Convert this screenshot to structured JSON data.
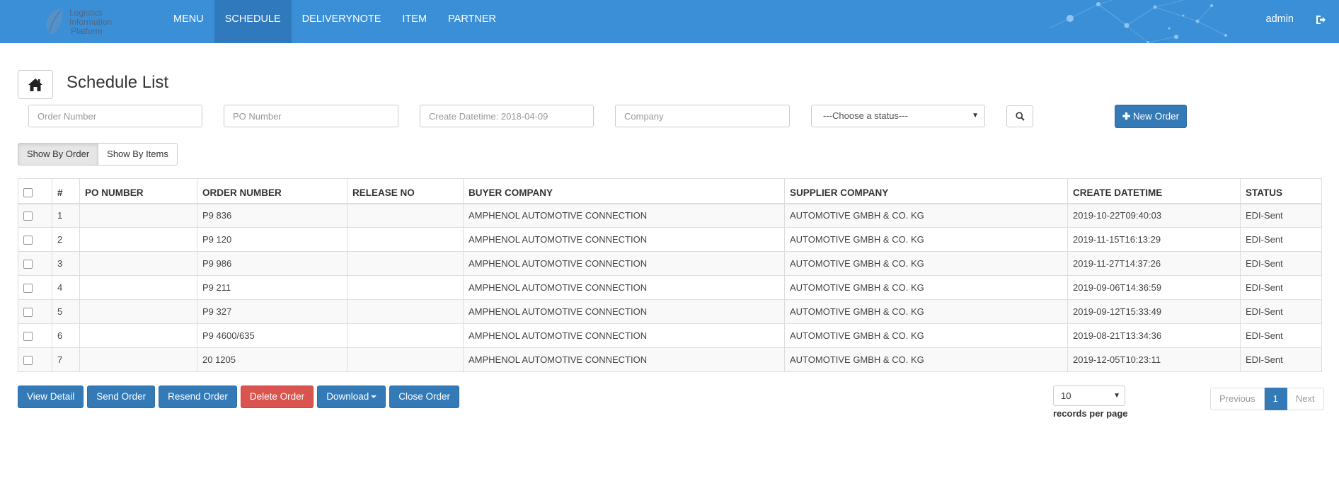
{
  "colors": {
    "navbar": "#3b8fd6",
    "nav_active": "#2f79bc",
    "primary": "#337ab7",
    "danger": "#d9534f"
  },
  "logo": {
    "line1": "Logistics",
    "line2": "Information",
    "line3": "Platform"
  },
  "nav": {
    "items": [
      {
        "label": "MENU"
      },
      {
        "label": "SCHEDULE"
      },
      {
        "label": "DELIVERYNOTE"
      },
      {
        "label": "ITEM"
      },
      {
        "label": "PARTNER"
      }
    ],
    "active": "SCHEDULE",
    "user": "admin"
  },
  "page": {
    "title": "Schedule List",
    "home_icon": "home-icon"
  },
  "filters": {
    "order_number_placeholder": "Order Number",
    "po_number_placeholder": "PO Number",
    "create_datetime_placeholder": "Create Datetime: 2018-04-09",
    "company_placeholder": "Company",
    "status_selected": "---Choose a status---",
    "new_order_label": "New Order"
  },
  "view_toggle": {
    "by_order": "Show By Order",
    "by_items": "Show By Items"
  },
  "table": {
    "headers": [
      "#",
      "PO NUMBER",
      "ORDER NUMBER",
      "RELEASE NO",
      "BUYER COMPANY",
      "SUPPLIER COMPANY",
      "CREATE DATETIME",
      "STATUS"
    ],
    "rows": [
      {
        "num": "1",
        "po": "",
        "order": "P9  836",
        "release": "",
        "buyer": "AMPHENOL AUTOMOTIVE CONNECTION",
        "supplier": "AUTOMOTIVE GMBH & CO. KG",
        "created": "2019-10-22T09:40:03",
        "status": "EDI-Sent"
      },
      {
        "num": "2",
        "po": "",
        "order": "P9  120",
        "release": "",
        "buyer": "AMPHENOL AUTOMOTIVE CONNECTION",
        "supplier": "AUTOMOTIVE GMBH & CO. KG",
        "created": "2019-11-15T16:13:29",
        "status": "EDI-Sent"
      },
      {
        "num": "3",
        "po": "",
        "order": "P9  986",
        "release": "",
        "buyer": "AMPHENOL AUTOMOTIVE CONNECTION",
        "supplier": "AUTOMOTIVE GMBH & CO. KG",
        "created": "2019-11-27T14:37:26",
        "status": "EDI-Sent"
      },
      {
        "num": "4",
        "po": "",
        "order": "P9  211",
        "release": "",
        "buyer": "AMPHENOL AUTOMOTIVE CONNECTION",
        "supplier": "AUTOMOTIVE GMBH & CO. KG",
        "created": "2019-09-06T14:36:59",
        "status": "EDI-Sent"
      },
      {
        "num": "5",
        "po": "",
        "order": "P9  327",
        "release": "",
        "buyer": "AMPHENOL AUTOMOTIVE CONNECTION",
        "supplier": "AUTOMOTIVE GMBH & CO. KG",
        "created": "2019-09-12T15:33:49",
        "status": "EDI-Sent"
      },
      {
        "num": "6",
        "po": "",
        "order": "P9  4600/635",
        "release": "",
        "buyer": "AMPHENOL AUTOMOTIVE CONNECTION",
        "supplier": "AUTOMOTIVE GMBH & CO. KG",
        "created": "2019-08-21T13:34:36",
        "status": "EDI-Sent"
      },
      {
        "num": "7",
        "po": "",
        "order": "20  1205",
        "release": "",
        "buyer": "AMPHENOL AUTOMOTIVE CONNECTION",
        "supplier": "AUTOMOTIVE GMBH & CO. KG",
        "created": "2019-12-05T10:23:11",
        "status": "EDI-Sent"
      }
    ]
  },
  "actions": {
    "view_detail": "View Detail",
    "send_order": "Send Order",
    "resend_order": "Resend Order",
    "delete_order": "Delete Order",
    "download": "Download",
    "close_order": "Close Order"
  },
  "pagination": {
    "per_page_value": "10",
    "per_page_label": "records per page",
    "previous": "Previous",
    "current": "1",
    "next": "Next"
  }
}
